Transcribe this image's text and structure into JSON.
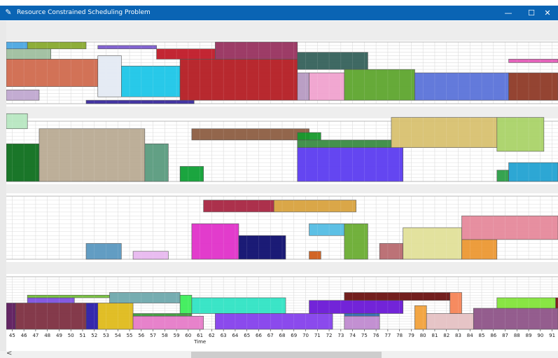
{
  "window": {
    "title": "Resource Constrained Scheduling Problem",
    "controls": {
      "minimize": "—",
      "maximize": "☐",
      "close": "✕"
    }
  },
  "chart_data": {
    "type": "gantt",
    "xlabel": "Time",
    "xlim": [
      44.5,
      91.5
    ],
    "x_ticks": [
      45,
      46,
      47,
      48,
      49,
      50,
      51,
      52,
      53,
      54,
      55,
      56,
      57,
      58,
      59,
      60,
      61,
      62,
      63,
      64,
      65,
      66,
      67,
      68,
      69,
      70,
      71,
      72,
      73,
      74,
      75,
      76,
      77,
      78,
      79,
      80,
      81,
      82,
      83,
      84,
      85,
      86,
      87,
      88,
      89,
      90,
      91
    ],
    "resources": [
      {
        "capacity": 9,
        "tasks": [
          {
            "start": 44.5,
            "end": 46.3,
            "lo": 8,
            "hi": 9,
            "color": "#4ba7e2"
          },
          {
            "start": 46.3,
            "end": 51.3,
            "lo": 8,
            "hi": 9,
            "color": "#88aa2e"
          },
          {
            "start": 44.5,
            "end": 48.3,
            "lo": 6.5,
            "hi": 8,
            "color": "#9fbf9f"
          },
          {
            "start": 44.5,
            "end": 52.3,
            "lo": 2.5,
            "hi": 6.5,
            "color": "#d06a4e"
          },
          {
            "start": 44.5,
            "end": 47.3,
            "lo": 0.5,
            "hi": 2,
            "color": "#c0a8d0"
          },
          {
            "start": 51.3,
            "end": 60.5,
            "lo": 0,
            "hi": 0.5,
            "color": "#3a2a9e"
          },
          {
            "start": 52.3,
            "end": 54.3,
            "lo": 1,
            "hi": 7,
            "color": "#e4eaf3"
          },
          {
            "start": 52.3,
            "end": 57.3,
            "lo": 8,
            "hi": 8.5,
            "color": "#7b5bcf"
          },
          {
            "start": 54.3,
            "end": 59.3,
            "lo": 1,
            "hi": 5.5,
            "color": "#1cc6e8"
          },
          {
            "start": 57.3,
            "end": 62.3,
            "lo": 6.5,
            "hi": 8,
            "color": "#c01a28"
          },
          {
            "start": 59.3,
            "end": 69.3,
            "lo": 0.5,
            "hi": 6.5,
            "color": "#b41e24"
          },
          {
            "start": 62.3,
            "end": 69.3,
            "lo": 6.5,
            "hi": 9,
            "color": "#98315f"
          },
          {
            "start": 69.3,
            "end": 75.3,
            "lo": 5,
            "hi": 7.5,
            "color": "#35615b"
          },
          {
            "start": 69.3,
            "end": 70.3,
            "lo": 0.5,
            "hi": 4.5,
            "color": "#b69ac2"
          },
          {
            "start": 70.3,
            "end": 73.3,
            "lo": 0.5,
            "hi": 4.5,
            "color": "#f0a2cf"
          },
          {
            "start": 73.3,
            "end": 79.3,
            "lo": 0.5,
            "hi": 5,
            "color": "#5ea52e"
          },
          {
            "start": 79.3,
            "end": 87.3,
            "lo": 0.5,
            "hi": 4.5,
            "color": "#5b73d9"
          },
          {
            "start": 87.3,
            "end": 91.5,
            "lo": 6,
            "hi": 6.5,
            "color": "#e25bb5"
          },
          {
            "start": 87.3,
            "end": 91.5,
            "lo": 0.5,
            "hi": 4.5,
            "color": "#8e3a27"
          }
        ]
      },
      {
        "capacity": 8,
        "tasks": [
          {
            "start": 44.5,
            "end": 46.3,
            "lo": 7,
            "hi": 9,
            "color": "#b7e7c1"
          },
          {
            "start": 44.5,
            "end": 47.3,
            "lo": 0,
            "hi": 5,
            "color": "#0e6f1e"
          },
          {
            "start": 47.3,
            "end": 56.3,
            "lo": 0,
            "hi": 7,
            "color": "#b9ab93"
          },
          {
            "start": 56.3,
            "end": 58.3,
            "lo": 0,
            "hi": 5,
            "color": "#5a9b7e"
          },
          {
            "start": 59.3,
            "end": 61.3,
            "lo": 0,
            "hi": 2,
            "color": "#0fa035"
          },
          {
            "start": 60.3,
            "end": 70.3,
            "lo": 5.5,
            "hi": 7,
            "color": "#8d5e42"
          },
          {
            "start": 69.3,
            "end": 71.3,
            "lo": 5.5,
            "hi": 6.5,
            "color": "#169a2c"
          },
          {
            "start": 69.3,
            "end": 77.3,
            "lo": 4.5,
            "hi": 5.5,
            "color": "#3a8b43"
          },
          {
            "start": 69.3,
            "end": 78.3,
            "lo": 0,
            "hi": 4.5,
            "color": "#5c3cf0"
          },
          {
            "start": 77.3,
            "end": 86.3,
            "lo": 4.5,
            "hi": 8.5,
            "color": "#d8c170"
          },
          {
            "start": 86.3,
            "end": 90.3,
            "lo": 4,
            "hi": 8.5,
            "color": "#aad368"
          },
          {
            "start": 86.3,
            "end": 87.3,
            "lo": 0,
            "hi": 1.5,
            "color": "#2b9e47"
          },
          {
            "start": 87.3,
            "end": 91.5,
            "lo": 0,
            "hi": 2.5,
            "color": "#22a2d2"
          }
        ]
      },
      {
        "capacity": 8,
        "tasks": [
          {
            "start": 51.3,
            "end": 54.3,
            "lo": 0,
            "hi": 2,
            "color": "#5a98c0"
          },
          {
            "start": 55.3,
            "end": 58.3,
            "lo": 0,
            "hi": 1,
            "color": "#e8b8ef"
          },
          {
            "start": 60.3,
            "end": 64.3,
            "lo": 0,
            "hi": 4.5,
            "color": "#e032c9"
          },
          {
            "start": 61.3,
            "end": 67.3,
            "lo": 6,
            "hi": 7.5,
            "color": "#a82642"
          },
          {
            "start": 64.3,
            "end": 68.3,
            "lo": 0,
            "hi": 3,
            "color": "#0f0f6f"
          },
          {
            "start": 67.3,
            "end": 74.3,
            "lo": 6,
            "hi": 7.5,
            "color": "#d8a23e"
          },
          {
            "start": 70.3,
            "end": 73.3,
            "lo": 3,
            "hi": 4.5,
            "color": "#54bde4"
          },
          {
            "start": 70.3,
            "end": 71.3,
            "lo": 0,
            "hi": 1,
            "color": "#cf5d1a"
          },
          {
            "start": 73.3,
            "end": 75.3,
            "lo": 0,
            "hi": 4.5,
            "color": "#6aad33"
          },
          {
            "start": 76.3,
            "end": 78.3,
            "lo": 0,
            "hi": 2,
            "color": "#b86a70"
          },
          {
            "start": 78.3,
            "end": 83.3,
            "lo": 0,
            "hi": 4,
            "color": "#e2e099"
          },
          {
            "start": 83.3,
            "end": 86.3,
            "lo": 0,
            "hi": 2.5,
            "color": "#ec9833"
          },
          {
            "start": 83.3,
            "end": 91.5,
            "lo": 2.5,
            "hi": 5.5,
            "color": "#e6899b"
          }
        ]
      },
      {
        "capacity": 10,
        "tasks": [
          {
            "start": 44.5,
            "end": 45.3,
            "lo": 0,
            "hi": 5,
            "color": "#5c1a5c"
          },
          {
            "start": 45.3,
            "end": 51.3,
            "lo": 0,
            "hi": 5,
            "color": "#7d2f41"
          },
          {
            "start": 46.3,
            "end": 50.3,
            "lo": 5,
            "hi": 6,
            "color": "#7e52e0"
          },
          {
            "start": 46.3,
            "end": 53.3,
            "lo": 6,
            "hi": 6.5,
            "color": "#74c23a"
          },
          {
            "start": 51.3,
            "end": 52.3,
            "lo": 0,
            "hi": 5,
            "color": "#2a1ea8"
          },
          {
            "start": 52.3,
            "end": 55.3,
            "lo": 0,
            "hi": 5,
            "color": "#dfba1b"
          },
          {
            "start": 53.3,
            "end": 59.3,
            "lo": 5,
            "hi": 7,
            "color": "#6fa9ad"
          },
          {
            "start": 55.3,
            "end": 60.3,
            "lo": 2.5,
            "hi": 3,
            "color": "#3e9a3c"
          },
          {
            "start": 55.3,
            "end": 61.3,
            "lo": 0,
            "hi": 2.5,
            "color": "#e67bc8"
          },
          {
            "start": 59.3,
            "end": 60.3,
            "lo": 3,
            "hi": 6.5,
            "color": "#3dee5a"
          },
          {
            "start": 60.3,
            "end": 68.3,
            "lo": 3,
            "hi": 6,
            "color": "#30e4c4"
          },
          {
            "start": 62.3,
            "end": 72.3,
            "lo": 0,
            "hi": 3,
            "color": "#8540ec"
          },
          {
            "start": 70.3,
            "end": 78.3,
            "lo": 3,
            "hi": 5.5,
            "color": "#6a18d6"
          },
          {
            "start": 73.3,
            "end": 76.3,
            "lo": 2.5,
            "hi": 3,
            "color": "#2f6db0"
          },
          {
            "start": 73.3,
            "end": 82.3,
            "lo": 5.5,
            "hi": 7,
            "color": "#6b1312"
          },
          {
            "start": 73.3,
            "end": 76.3,
            "lo": 0,
            "hi": 2.5,
            "color": "#c08ad0"
          },
          {
            "start": 79.3,
            "end": 80.3,
            "lo": 0,
            "hi": 4.5,
            "color": "#f2a13a"
          },
          {
            "start": 80.3,
            "end": 84.3,
            "lo": 0,
            "hi": 3,
            "color": "#e5c1c3"
          },
          {
            "start": 82.3,
            "end": 83.3,
            "lo": 3,
            "hi": 7,
            "color": "#f58557"
          },
          {
            "start": 84.3,
            "end": 91.5,
            "lo": 0,
            "hi": 4,
            "color": "#8e5488"
          },
          {
            "start": 86.3,
            "end": 91.3,
            "lo": 4,
            "hi": 6,
            "color": "#83e43a"
          },
          {
            "start": 91.3,
            "end": 91.5,
            "lo": 4,
            "hi": 6,
            "color": "#801010"
          }
        ]
      }
    ]
  }
}
